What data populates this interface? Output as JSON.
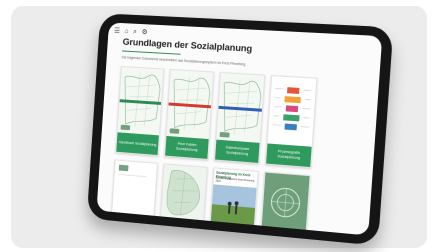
{
  "toolbar": {
    "icons": [
      "menu-icon",
      "home-icon",
      "search-icon",
      "settings-icon"
    ]
  },
  "page": {
    "title": "Grundlagen der Sozialplanung",
    "subtitle": "Die folgenden Dokumente beschreiben das Sozialplanungssystem im Kreis Pinneberg"
  },
  "documents": [
    {
      "label": "Handbuch Sozialplanung",
      "band": "#2e8b57"
    },
    {
      "label": "Pinzi Fakten Sozialplanung",
      "band": "#d43a2f"
    },
    {
      "label": "Datenkompass Sozialplanung",
      "band": "#2f5fb3"
    },
    {
      "label": "Prozessgrafik Sozialplanung",
      "band": ""
    }
  ],
  "documents_row2": [
    {
      "title": "",
      "sub": ""
    },
    {
      "title": "",
      "sub": ""
    },
    {
      "title": "Sozialplanung im Kreis Pinneberg",
      "sub": "Bevölkerungsbericht Kreis Pinneberg 2022"
    },
    {
      "title": "",
      "sub": ""
    }
  ],
  "colors": {
    "accent": "#2f9a5d",
    "frame": "#151515"
  }
}
